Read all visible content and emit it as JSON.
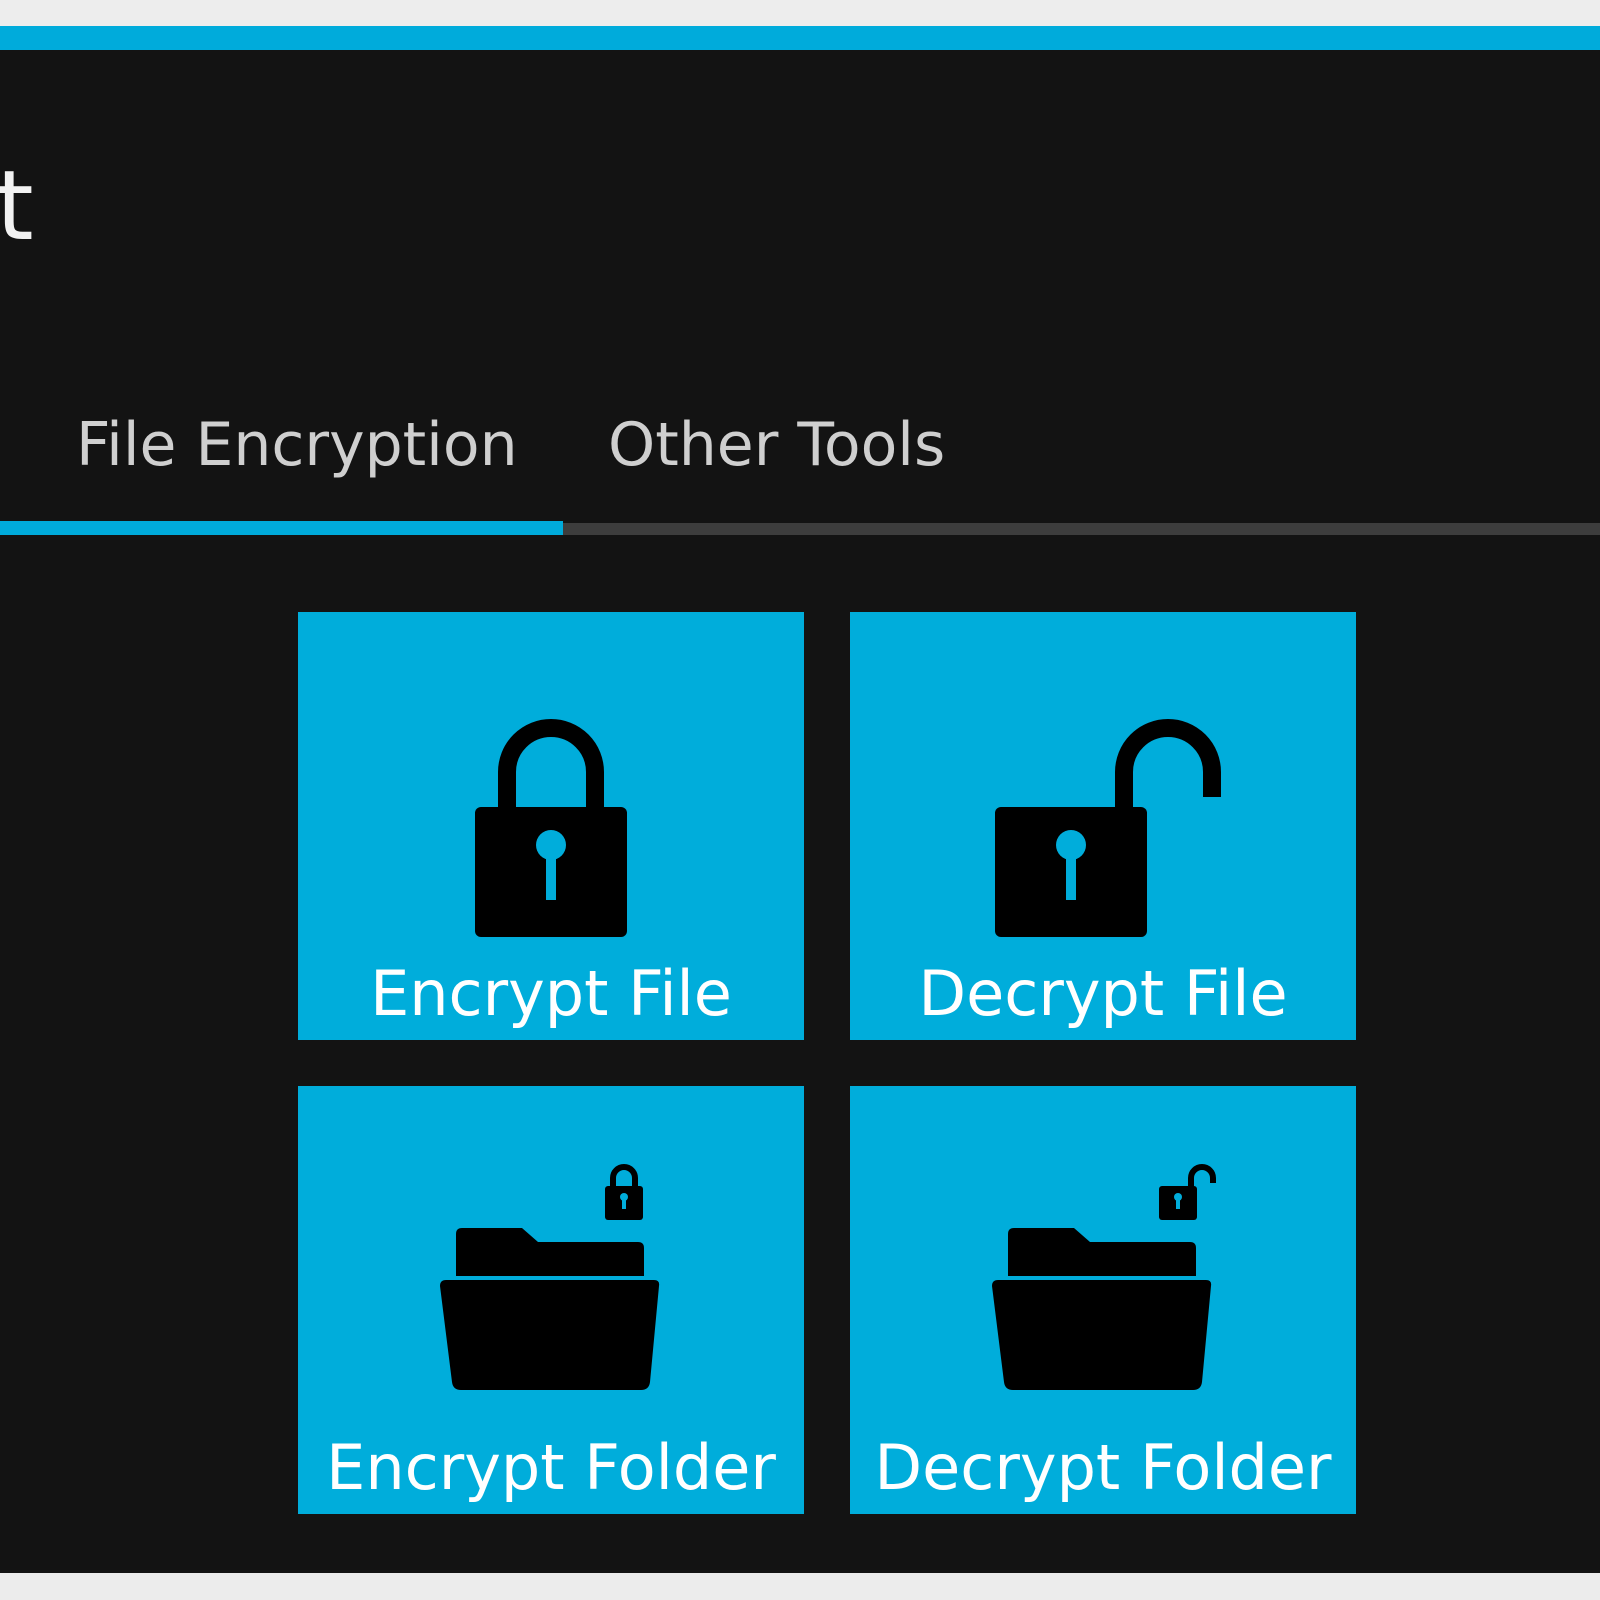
{
  "window": {
    "title_fragment": "t",
    "accent_color": "#00abdb",
    "background_color": "#131313"
  },
  "tabs": [
    {
      "label": "File Encryption",
      "selected": true
    },
    {
      "label": "Other Tools",
      "selected": false
    }
  ],
  "tiles": [
    {
      "label": "Encrypt File",
      "icon": "lock-closed-icon"
    },
    {
      "label": "Decrypt File",
      "icon": "lock-open-icon"
    },
    {
      "label": "Encrypt Folder",
      "icon": "folder-lock-icon"
    },
    {
      "label": "Decrypt Folder",
      "icon": "folder-unlock-icon"
    }
  ],
  "tile_color": "#00addb"
}
